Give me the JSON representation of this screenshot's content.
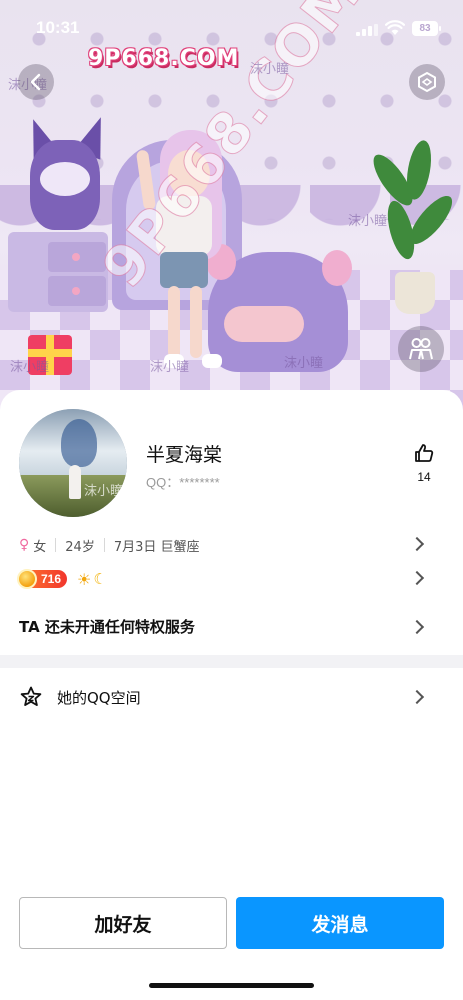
{
  "status_bar": {
    "time": "10:31",
    "battery": "83"
  },
  "watermark": {
    "site_logo": "9P668.COM",
    "diagonal_text": "9P668.COM",
    "author_tag": "沫小瞳"
  },
  "hero": {
    "back_icon": "chevron-left-icon",
    "top_right_icon": "hexagon-icon",
    "people_icon": "people-icon"
  },
  "profile": {
    "nickname": "半夏海棠",
    "qq_label": "QQ：",
    "qq_masked": "********",
    "likes": "14",
    "gender": "女",
    "gender_symbol": "♀",
    "age": "24岁",
    "birthday_sign": "7月3日 巨蟹座",
    "level": "716"
  },
  "vip": {
    "text": "TA 还未开通任何特权服务"
  },
  "qzone": {
    "label": "她的QQ空间"
  },
  "actions": {
    "add_friend": "加好友",
    "send_message": "发消息"
  },
  "colors": {
    "primary_button": "#0a96ff",
    "badge_gradient_start": "#ff7a2e",
    "badge_gradient_end": "#f1362d",
    "female_symbol": "#f06aa0"
  }
}
